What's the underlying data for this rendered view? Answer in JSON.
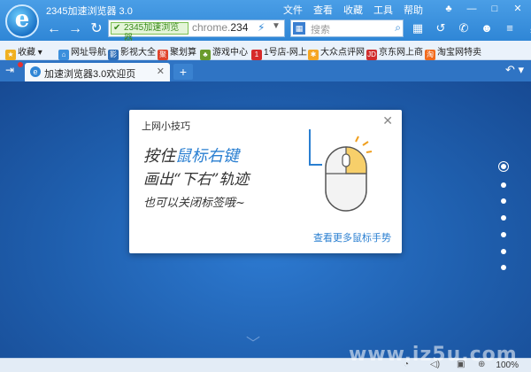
{
  "window": {
    "title": "2345加速浏览器 3.0",
    "menus": [
      "文件",
      "查看",
      "收藏",
      "工具",
      "帮助"
    ]
  },
  "toolbar": {
    "ssl_label": "2345加速浏览器",
    "url_prefix": "chrome.",
    "url_rest": "234",
    "search_placeholder": "搜索"
  },
  "bookmarks": [
    {
      "label": "收藏",
      "icon": "star-icon",
      "color": "#f0b020"
    },
    {
      "label": "网址导航",
      "icon": "nav-icon",
      "color": "#3b8fdc"
    },
    {
      "label": "影视大全",
      "icon": "video-icon",
      "color": "#2f6fb8"
    },
    {
      "label": "聚划算",
      "icon": "ju-icon",
      "color": "#e0442c"
    },
    {
      "label": "游戏中心",
      "icon": "game-icon",
      "color": "#6a9b2c"
    },
    {
      "label": "1号店-网上",
      "icon": "yhd-icon",
      "color": "#d62a2a"
    },
    {
      "label": "大众点评网",
      "icon": "dianping-icon",
      "color": "#f5a623"
    },
    {
      "label": "京东网上商",
      "icon": "jd-icon",
      "color": "#d12c2c"
    },
    {
      "label": "淘宝网特卖",
      "icon": "taobao-icon",
      "color": "#f26b1d"
    }
  ],
  "tab": {
    "title": "加速浏览器3.0欢迎页",
    "new_tab": "+"
  },
  "tips": {
    "title": "上网小技巧",
    "line1_a": "按住",
    "line1_b": "鼠标右键",
    "line2": "画出“下右”轨迹",
    "line3": "也可以关闭标签哦~",
    "more_link": "查看更多鼠标手势"
  },
  "status": {
    "zoom": "100%"
  },
  "watermark": "www.iz5u.com"
}
